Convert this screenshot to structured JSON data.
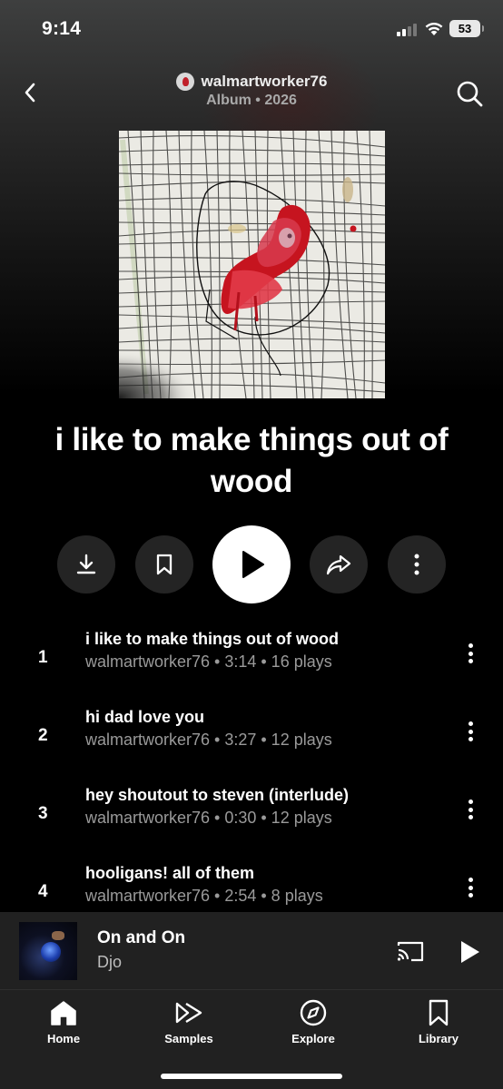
{
  "status_bar": {
    "time": "9:14",
    "battery": "53"
  },
  "header": {
    "artist": "walmartworker76",
    "subtitle": "Album • 2026"
  },
  "album": {
    "title": "i like to make things out of wood"
  },
  "actions": [
    "download-icon",
    "bookmark-icon",
    "play-icon",
    "share-icon",
    "more-vertical-icon"
  ],
  "tracks": [
    {
      "num": "1",
      "title": "i like to make things out of wood",
      "meta": "walmartworker76 • 3:14 • 16 plays"
    },
    {
      "num": "2",
      "title": "hi dad love you",
      "meta": "walmartworker76 • 3:27 • 12 plays"
    },
    {
      "num": "3",
      "title": "hey shoutout to steven (interlude)",
      "meta": "walmartworker76 • 0:30 • 12 plays"
    },
    {
      "num": "4",
      "title": "hooligans! all of them",
      "meta": "walmartworker76 • 2:54 • 8 plays"
    }
  ],
  "now_playing": {
    "title": "On and On",
    "artist": "Djo"
  },
  "nav": {
    "items": [
      {
        "label": "Home",
        "icon": "home-icon",
        "active": true
      },
      {
        "label": "Samples",
        "icon": "samples-icon"
      },
      {
        "label": "Explore",
        "icon": "compass-icon"
      },
      {
        "label": "Library",
        "icon": "library-icon"
      }
    ]
  },
  "colors": {
    "background": "#000000",
    "surface": "#212121",
    "button": "#242424",
    "meta_text": "#9a9a9a"
  }
}
